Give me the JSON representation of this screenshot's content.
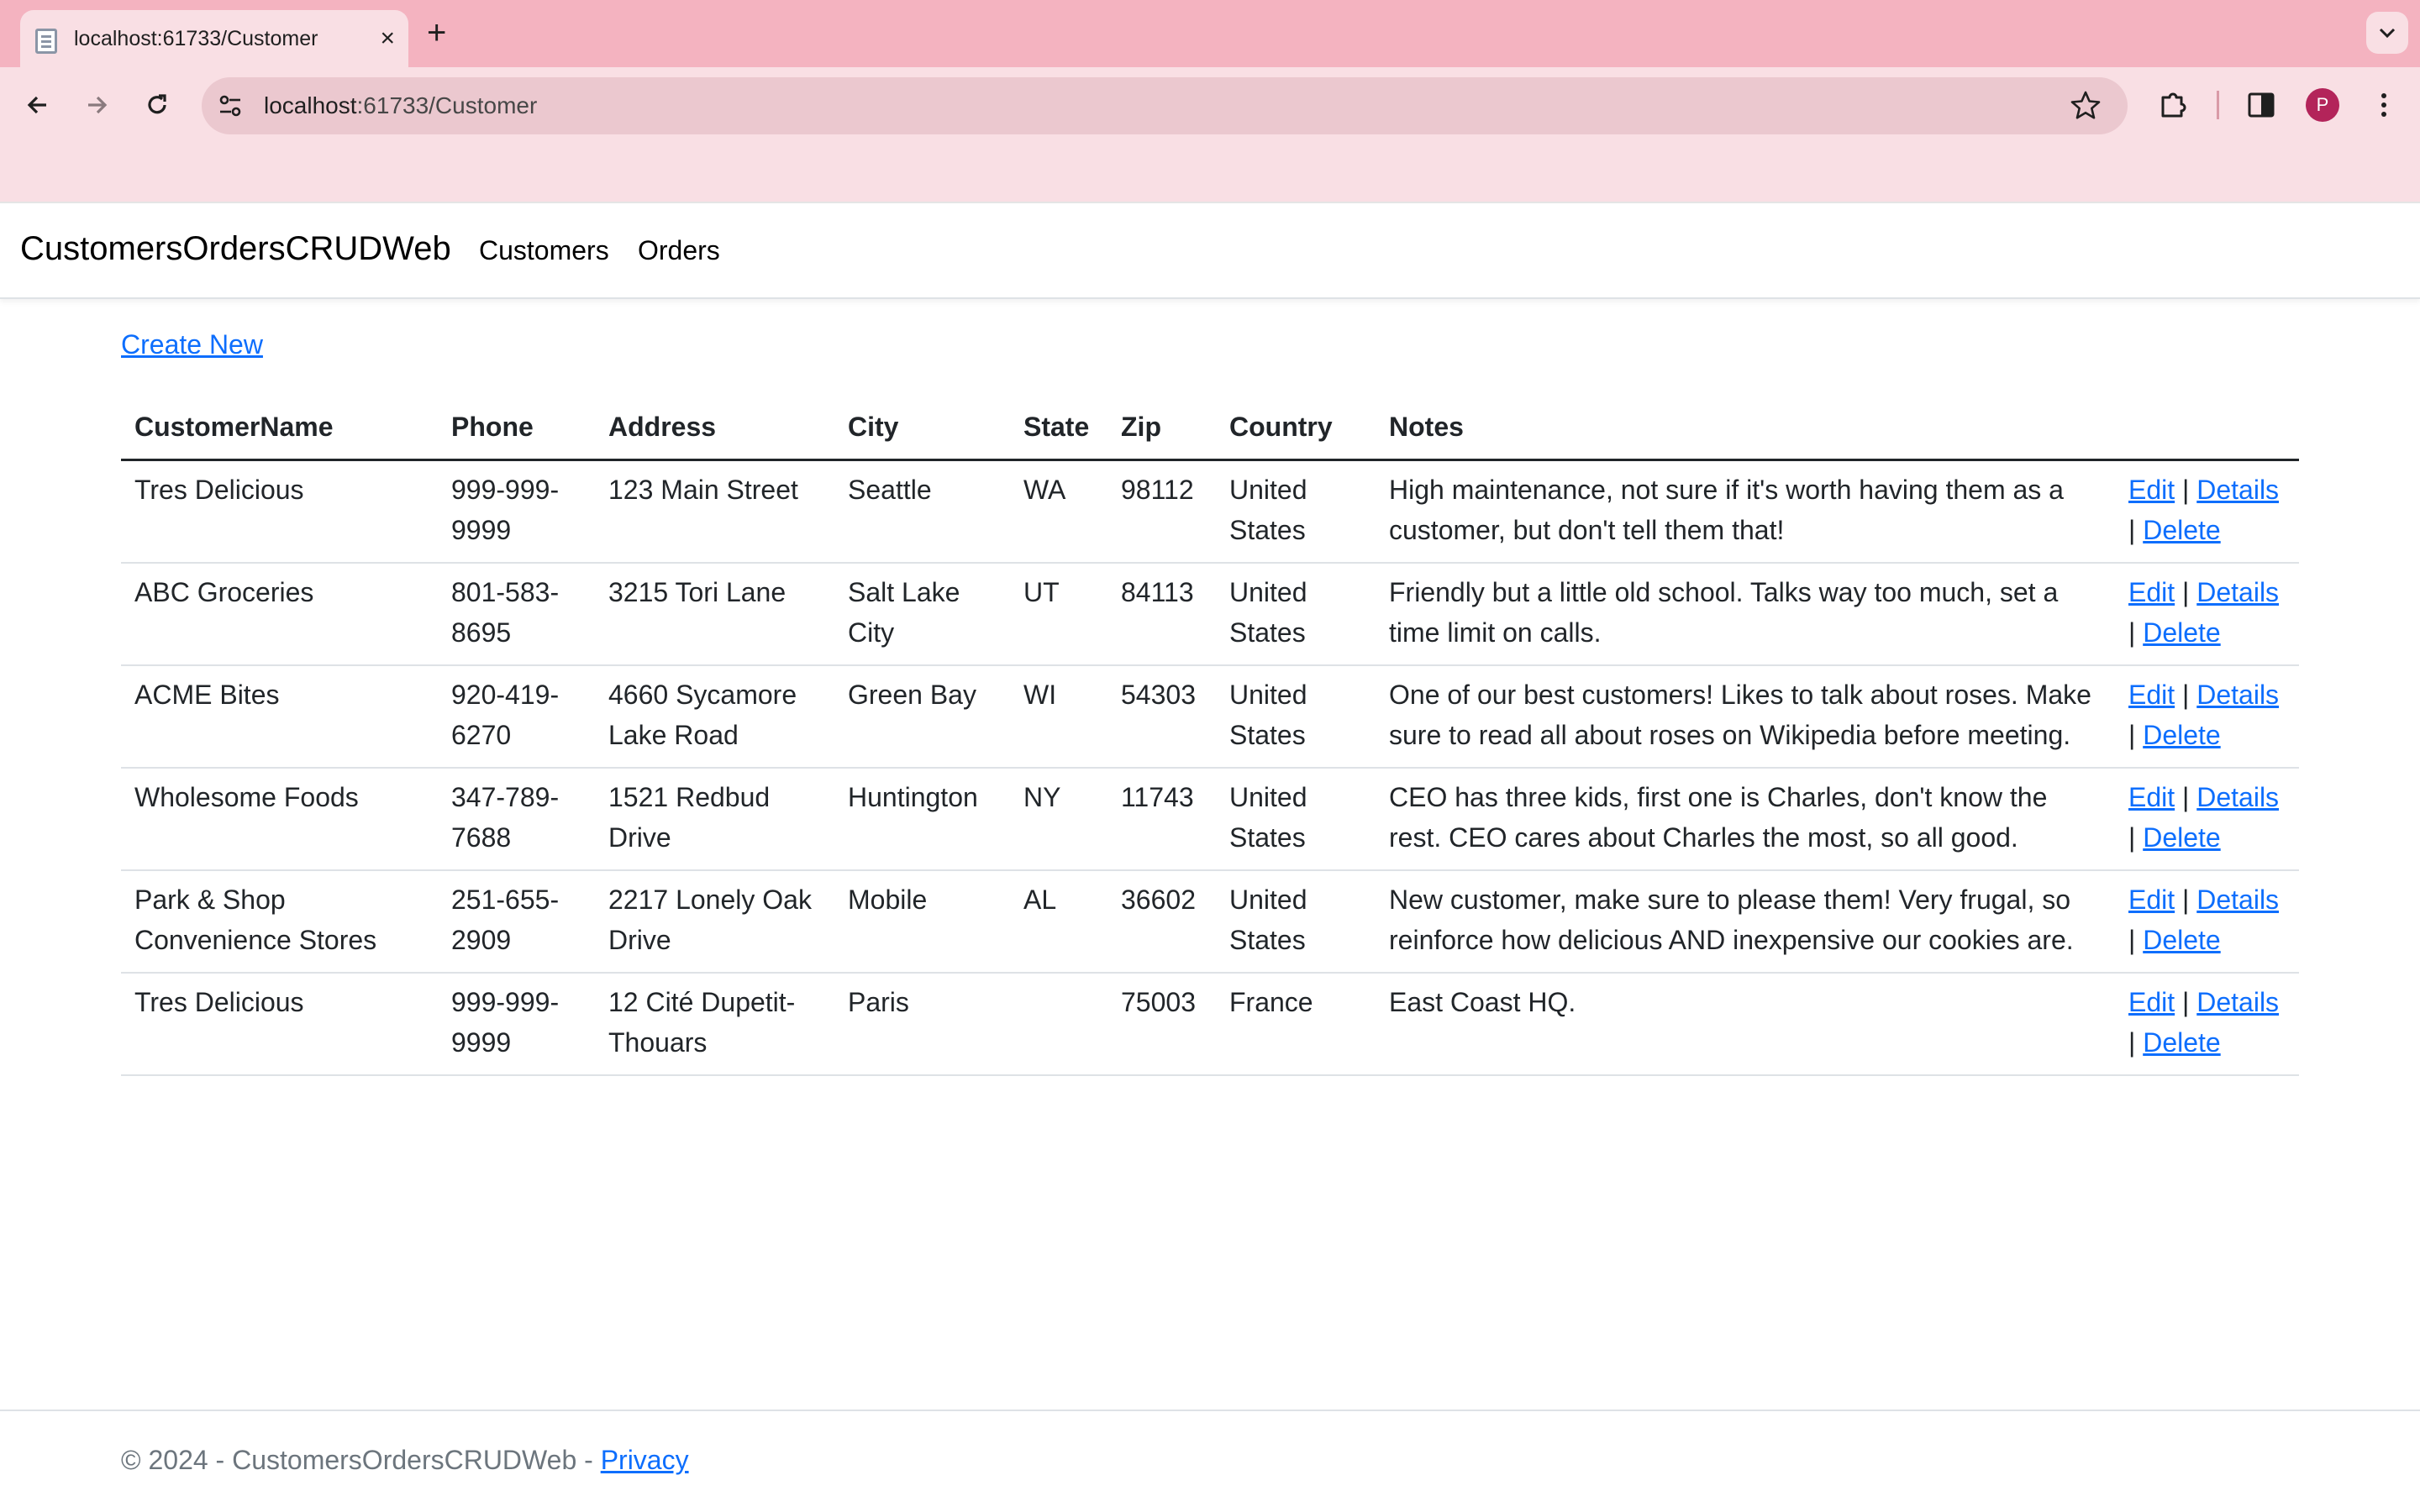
{
  "browser": {
    "tab_title": "localhost:61733/Customer",
    "tab_close": "×",
    "new_tab": "+",
    "url_host": "localhost",
    "url_path": ":61733/Customer",
    "profile_initial": "P"
  },
  "navbar": {
    "brand": "CustomersOrdersCRUDWeb",
    "links": [
      "Customers",
      "Orders"
    ]
  },
  "main": {
    "create_new": "Create New",
    "columns": [
      "CustomerName",
      "Phone",
      "Address",
      "City",
      "State",
      "Zip",
      "Country",
      "Notes"
    ],
    "actions": {
      "edit": "Edit",
      "details": "Details",
      "delete": "Delete",
      "sep": "|"
    },
    "rows": [
      {
        "name": "Tres Delicious",
        "phone": "999-999-9999",
        "address": "123 Main Street",
        "city": "Seattle",
        "state": "WA",
        "zip": "98112",
        "country": "United States",
        "notes": "High maintenance, not sure if it's worth having them as a customer, but don't tell them that!"
      },
      {
        "name": "ABC Groceries",
        "phone": "801-583-8695",
        "address": "3215 Tori Lane",
        "city": "Salt Lake City",
        "state": "UT",
        "zip": "84113",
        "country": "United States",
        "notes": "Friendly but a little old school. Talks way too much, set a time limit on calls."
      },
      {
        "name": "ACME Bites",
        "phone": "920-419-6270",
        "address": "4660 Sycamore Lake Road",
        "city": "Green Bay",
        "state": "WI",
        "zip": "54303",
        "country": "United States",
        "notes": "One of our best customers! Likes to talk about roses. Make sure to read all about roses on Wikipedia before meeting."
      },
      {
        "name": "Wholesome Foods",
        "phone": "347-789-7688",
        "address": "1521 Redbud Drive",
        "city": "Huntington",
        "state": "NY",
        "zip": "11743",
        "country": "United States",
        "notes": "CEO has three kids, first one is Charles, don't know the rest. CEO cares about Charles the most, so all good."
      },
      {
        "name": "Park & Shop Convenience Stores",
        "phone": "251-655-2909",
        "address": "2217 Lonely Oak Drive",
        "city": "Mobile",
        "state": "AL",
        "zip": "36602",
        "country": "United States",
        "notes": "New customer, make sure to please them! Very frugal, so reinforce how delicious AND inexpensive our cookies are."
      },
      {
        "name": "Tres Delicious",
        "phone": "999-999-9999",
        "address": "12 Cité Dupetit-Thouars",
        "city": "Paris",
        "state": "",
        "zip": "75003",
        "country": "France",
        "notes": "East Coast HQ."
      }
    ]
  },
  "footer": {
    "text": "© 2024 - CustomersOrdersCRUDWeb - ",
    "privacy": "Privacy"
  }
}
